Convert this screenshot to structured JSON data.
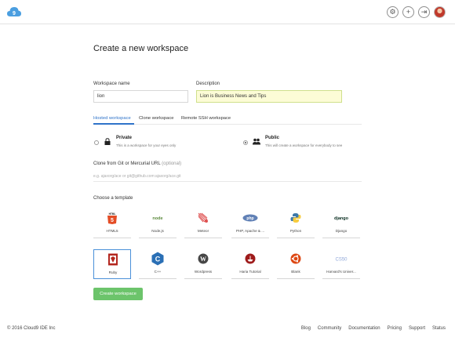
{
  "header": {
    "logo_icon": "cloud9-logo-icon",
    "actions": [
      {
        "icon": "gear-icon",
        "glyph": "⚙"
      },
      {
        "icon": "plus-icon",
        "glyph": "+"
      },
      {
        "icon": "logout-icon",
        "glyph": "⇥"
      }
    ],
    "avatar_icon": "user-avatar"
  },
  "page": {
    "title": "Create a new workspace"
  },
  "form": {
    "workspace_name_label": "Workspace name",
    "workspace_name_value": "lion",
    "description_label": "Description",
    "description_value": "Lion is Business News and Tips"
  },
  "tabs": [
    {
      "label": "Hosted workspace",
      "active": true
    },
    {
      "label": "Clone workspace",
      "active": false
    },
    {
      "label": "Remote SSH workspace",
      "active": false
    }
  ],
  "visibility": {
    "private": {
      "title": "Private",
      "desc": "This is a workspace for your eyes only",
      "icon": "lock-icon",
      "selected": false
    },
    "public": {
      "title": "Public",
      "desc": "This will create a workspace for everybody to see",
      "icon": "group-icon",
      "selected": true
    }
  },
  "clone": {
    "label": "Clone from Git or Mercurial URL",
    "optional": "(optional)",
    "placeholder": "e.g. ajaxorg/ace or git@github.com:ajaxorg/ace.git"
  },
  "templates_label": "Choose a template",
  "templates": [
    {
      "name": "HTML5",
      "icon": "html5-icon",
      "selected": false
    },
    {
      "name": "Node.js",
      "icon": "nodejs-icon",
      "selected": false
    },
    {
      "name": "Meteor",
      "icon": "meteor-icon",
      "selected": false
    },
    {
      "name": "PHP, Apache & ...",
      "icon": "php-icon",
      "selected": false
    },
    {
      "name": "Python",
      "icon": "python-icon",
      "selected": false
    },
    {
      "name": "Django",
      "icon": "django-icon",
      "selected": false
    },
    {
      "name": "Ruby",
      "icon": "ruby-icon",
      "selected": true
    },
    {
      "name": "C++",
      "icon": "cpp-icon",
      "selected": false
    },
    {
      "name": "Wordpress",
      "icon": "wordpress-icon",
      "selected": false
    },
    {
      "name": "Haria Tutorial",
      "icon": "harbour-icon",
      "selected": false
    },
    {
      "name": "Blank",
      "icon": "ubuntu-icon",
      "selected": false
    },
    {
      "name": "Harvard's Univer...",
      "icon": "cs50-icon",
      "selected": false
    }
  ],
  "create_button": "Create workspace",
  "footer": {
    "copyright": "© 2016 Cloud9 IDE Inc",
    "links": [
      "Blog",
      "Community",
      "Documentation",
      "Pricing",
      "Support",
      "Status"
    ]
  },
  "colors": {
    "accent": "#2f73c9",
    "create_button": "#6cc46b",
    "highlight_input": "#fcfcd6"
  }
}
